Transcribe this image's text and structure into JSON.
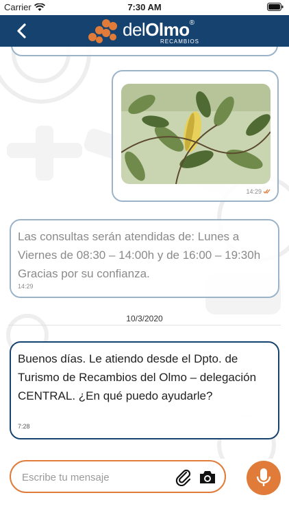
{
  "status_bar": {
    "carrier": "Carrier",
    "time": "7:30 AM"
  },
  "header": {
    "logo": {
      "prefix": "del",
      "name": "Olmo",
      "registered": "®",
      "subtitle": "RECAMBIOS"
    }
  },
  "chat": {
    "image_message": {
      "time": "14:29",
      "status_icon": "double-check-icon"
    },
    "hours_message": {
      "text": "Las consultas serán atendidas de: Lunes a Viernes de 08:30 – 14:00h y de 16:00 – 19:30h Gracias por su confianza.",
      "time": "14:29"
    },
    "date_separator": "10/3/2020",
    "greeting_message": {
      "text": "Buenos días. Le atiendo desde el Dpto. de Turismo de Recambios del Olmo – delegación CENTRAL. ¿En qué puedo ayudarle?",
      "time": "7:28"
    }
  },
  "composer": {
    "placeholder": "Escribe tu mensaje",
    "value": ""
  },
  "colors": {
    "navbar": "#15426e",
    "accent": "#e07b39",
    "bubble_border": "#9bb3c9"
  }
}
